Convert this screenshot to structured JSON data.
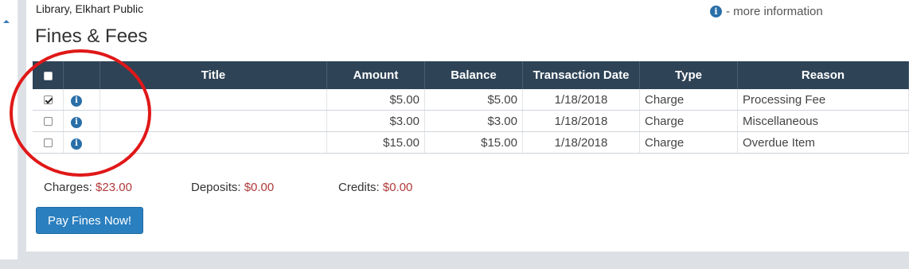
{
  "header": {
    "library_name": "Library, Elkhart Public",
    "more_info_text": "- more information",
    "page_title": "Fines & Fees"
  },
  "table": {
    "columns": {
      "title": "Title",
      "amount": "Amount",
      "balance": "Balance",
      "transaction_date": "Transaction Date",
      "type": "Type",
      "reason": "Reason"
    },
    "rows": [
      {
        "checked": true,
        "title": "",
        "amount": "$5.00",
        "balance": "$5.00",
        "date": "1/18/2018",
        "type": "Charge",
        "reason": "Processing Fee"
      },
      {
        "checked": false,
        "title": "",
        "amount": "$3.00",
        "balance": "$3.00",
        "date": "1/18/2018",
        "type": "Charge",
        "reason": "Miscellaneous"
      },
      {
        "checked": false,
        "title": "",
        "amount": "$15.00",
        "balance": "$15.00",
        "date": "1/18/2018",
        "type": "Charge",
        "reason": "Overdue Item"
      }
    ]
  },
  "totals": {
    "charges_label": "Charges",
    "charges_value": "$23.00",
    "deposits_label": "Deposits",
    "deposits_value": "$0.00",
    "credits_label": "Credits",
    "credits_value": "$0.00",
    "separator": ": "
  },
  "actions": {
    "pay_button": "Pay Fines Now!"
  },
  "icons": {
    "info": "info-icon",
    "info_glyph": "i"
  },
  "colors": {
    "header_bg": "#2e4356",
    "accent_blue": "#2a7fbf",
    "amount_red": "#b03a3a",
    "annotation_red": "#e01818"
  }
}
